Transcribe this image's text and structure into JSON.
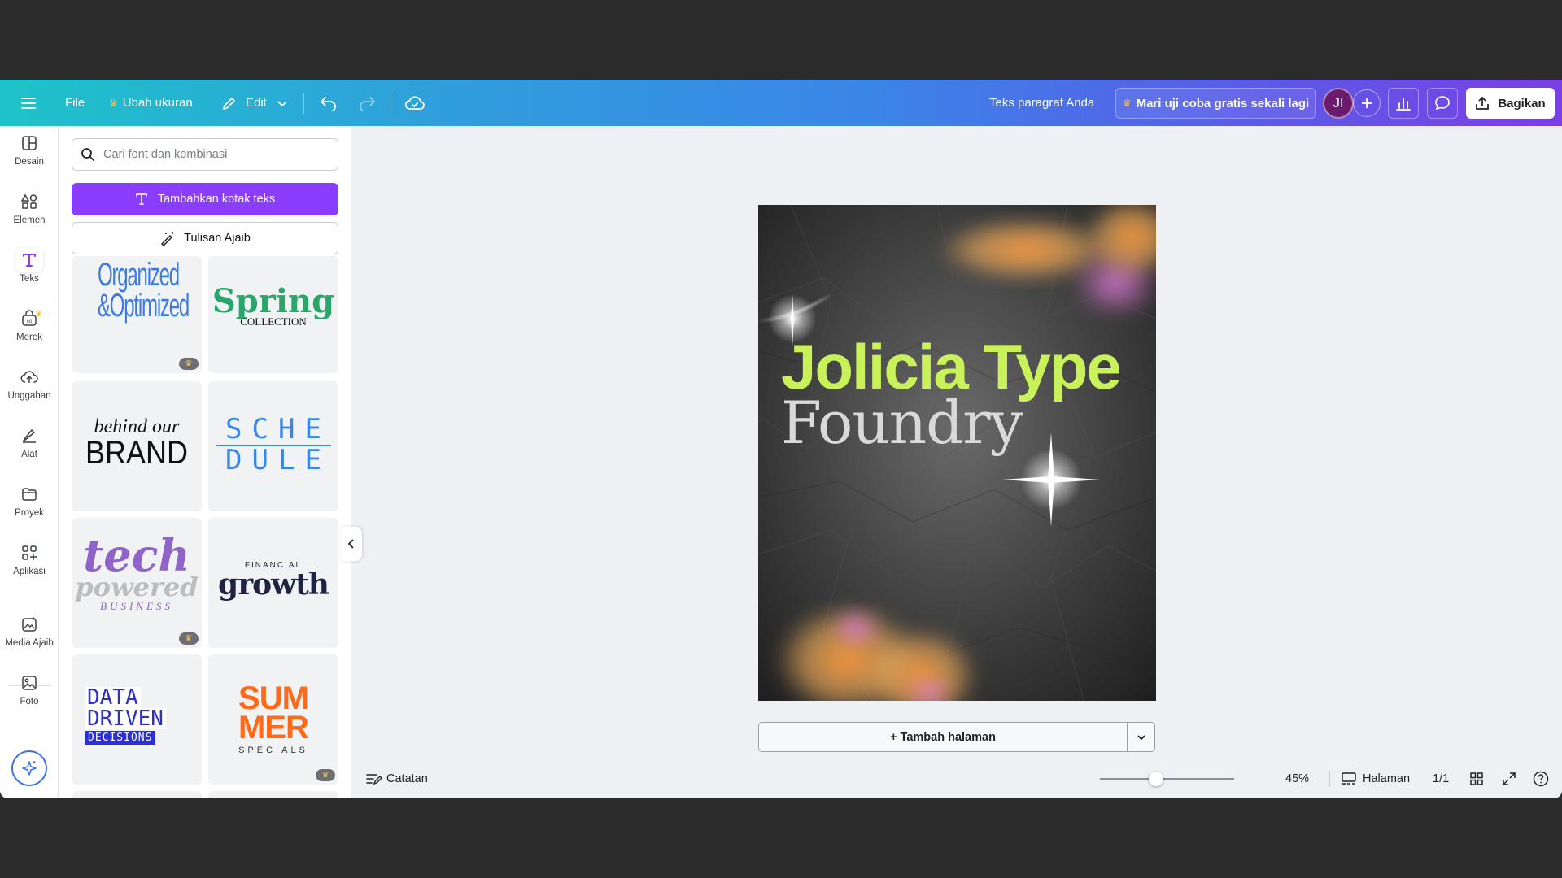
{
  "topbar": {
    "menu_icon": "hamburger-icon",
    "file_label": "File",
    "resize_label": "Ubah ukuran",
    "edit_label": "Edit",
    "doc_title": "Teks paragraf Anda",
    "trial_label": "Mari uji coba gratis sekali lagi",
    "avatar_initials": "JI",
    "share_label": "Bagikan"
  },
  "rail": {
    "items": [
      {
        "label": "Desain",
        "icon": "layout-icon"
      },
      {
        "label": "Elemen",
        "icon": "shapes-icon"
      },
      {
        "label": "Teks",
        "icon": "text-icon"
      },
      {
        "label": "Merek",
        "icon": "brand-icon"
      },
      {
        "label": "Unggahan",
        "icon": "upload-icon"
      },
      {
        "label": "Alat",
        "icon": "draw-icon"
      },
      {
        "label": "Proyek",
        "icon": "folder-icon"
      },
      {
        "label": "Aplikasi",
        "icon": "apps-icon"
      },
      {
        "label": "Media Ajaib",
        "icon": "magic-media-icon"
      },
      {
        "label": "Foto",
        "icon": "photo-icon"
      }
    ]
  },
  "panel": {
    "search_placeholder": "Cari font dan kombinasi",
    "add_text_label": "Tambahkan kotak teks",
    "magic_write_label": "Tulisan Ajaib",
    "tiles": [
      {
        "lines": [
          "Organized",
          "&Optimized"
        ],
        "pro": true
      },
      {
        "lines": [
          "Spring",
          "COLLECTION"
        ],
        "pro": false
      },
      {
        "lines": [
          "behind our",
          "BRAND"
        ],
        "pro": false
      },
      {
        "lines": [
          "SCHE",
          "DULE"
        ],
        "pro": false
      },
      {
        "lines": [
          "tech",
          "powered",
          "BUSINESS"
        ],
        "pro": true
      },
      {
        "lines": [
          "FINANCIAL",
          "growth"
        ],
        "pro": false
      },
      {
        "lines": [
          "DATA",
          "DRIVEN",
          "DECISIONS"
        ],
        "pro": false
      },
      {
        "lines": [
          "SUM",
          "MER",
          "SPECIALS"
        ],
        "pro": true
      }
    ]
  },
  "canvas": {
    "headline": "Jolicia Type",
    "subline": "Foundry",
    "add_page_label": "+ Tambah halaman"
  },
  "bottombar": {
    "notes_label": "Catatan",
    "zoom_level": "45%",
    "zoom_fraction": 0.42,
    "pages_label": "Halaman",
    "page_count": "1/1"
  },
  "colors": {
    "accent_purple": "#8b3dff",
    "headline_green": "#c9f25a"
  }
}
